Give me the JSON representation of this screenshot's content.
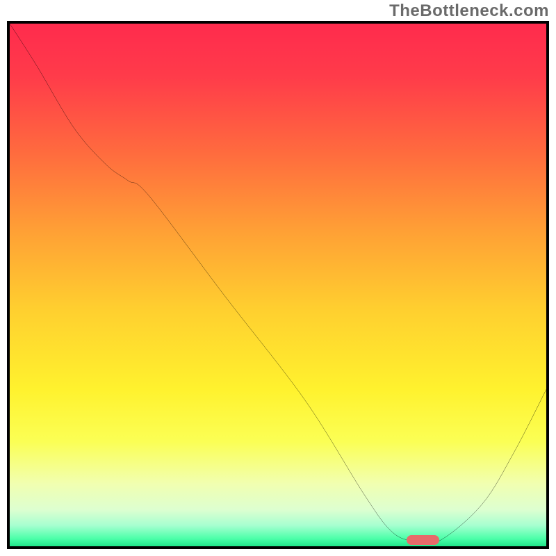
{
  "watermark": "TheBottleneck.com",
  "chart_data": {
    "type": "line",
    "title": "",
    "xlabel": "",
    "ylabel": "",
    "x_range": [
      0,
      100
    ],
    "y_range": [
      0,
      100
    ],
    "grid": false,
    "legend": false,
    "series": [
      {
        "name": "bottleneck-curve",
        "x": [
          0,
          5,
          12,
          18,
          22,
          26,
          40,
          55,
          66,
          71,
          75,
          80,
          88,
          94,
          100
        ],
        "y": [
          100,
          92,
          80,
          73,
          70,
          67,
          48,
          28,
          10,
          3,
          1,
          1,
          8,
          18,
          30
        ],
        "color": "#000000"
      }
    ],
    "marker": {
      "name": "optimal-range",
      "x_start": 74,
      "x_end": 80,
      "y": 1,
      "color": "#e86a6a"
    },
    "background_gradient": {
      "direction": "vertical",
      "stops": [
        {
          "pos": 0.0,
          "color": "#ff2b4d"
        },
        {
          "pos": 0.25,
          "color": "#ff6c3e"
        },
        {
          "pos": 0.5,
          "color": "#ffd02f"
        },
        {
          "pos": 0.75,
          "color": "#fbff55"
        },
        {
          "pos": 0.95,
          "color": "#a7ffd0"
        },
        {
          "pos": 1.0,
          "color": "#20e78a"
        }
      ]
    }
  }
}
